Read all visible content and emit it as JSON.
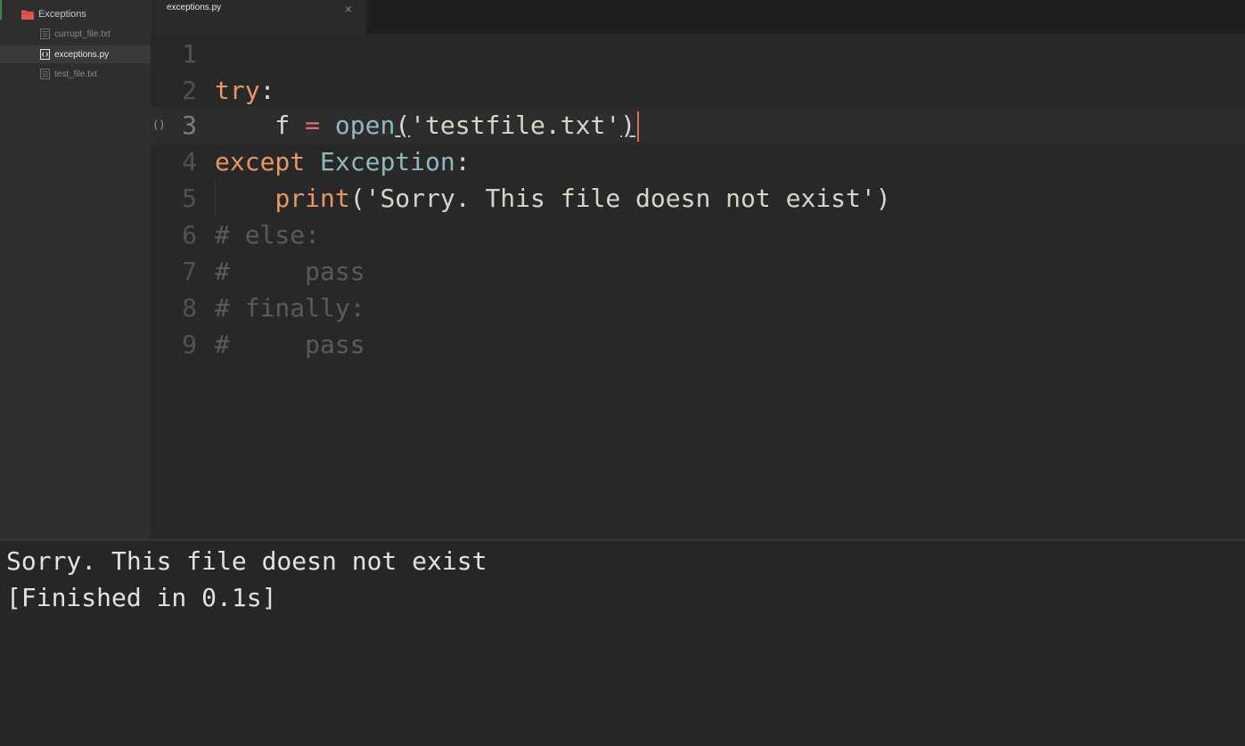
{
  "sidebar": {
    "folder": {
      "label": "Exceptions",
      "icon": "folder-icon",
      "color": "#e2574c"
    },
    "files": [
      {
        "label": "currupt_file.txt",
        "icon": "text-file-icon",
        "active": false
      },
      {
        "label": "exceptions.py",
        "icon": "python-file-icon",
        "active": true
      },
      {
        "label": "test_file.txt",
        "icon": "text-file-icon",
        "active": false
      }
    ]
  },
  "tabs": [
    {
      "label": "exceptions.py",
      "close_glyph": "×"
    }
  ],
  "editor": {
    "fold_marker": "()",
    "line_numbers": [
      "1",
      "2",
      "3",
      "4",
      "5",
      "6",
      "7",
      "8",
      "9"
    ],
    "current_line": 3,
    "lines": [
      "",
      "try:",
      "    f = open('testfile.txt')",
      "except Exception:",
      "    print('Sorry. This file doesn not exist')",
      "# else:",
      "#     pass",
      "# finally:",
      "#     pass"
    ]
  },
  "console": {
    "lines": [
      "Sorry. This file doesn not exist",
      "[Finished in 0.1s]"
    ]
  },
  "colors": {
    "keyword": "#e89764",
    "class": "#8fb8bf",
    "operator": "#e06b74",
    "comment": "#5a5a5a",
    "cursor": "#e06b54"
  }
}
